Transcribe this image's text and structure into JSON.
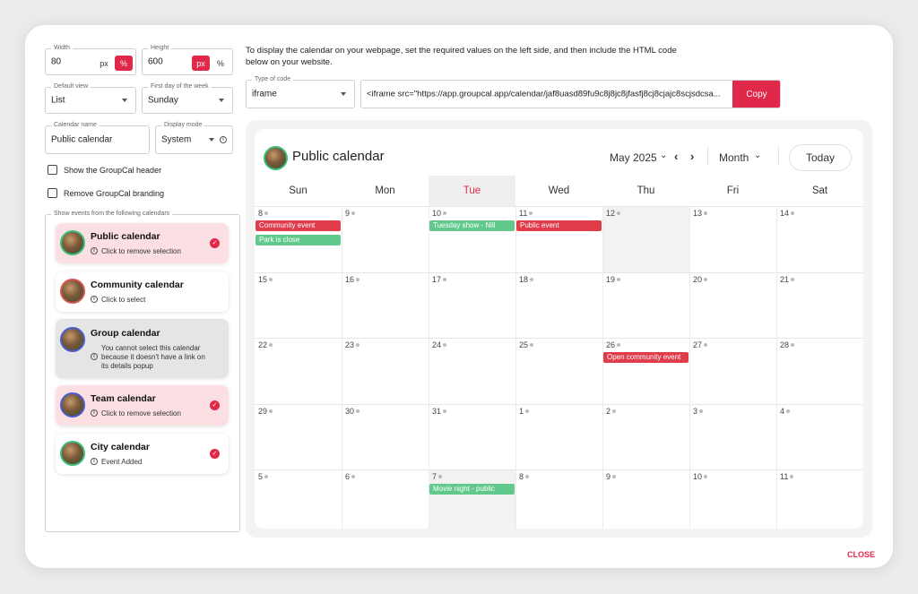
{
  "settings": {
    "width": {
      "label": "Width",
      "value": "80",
      "unit_px": "px",
      "unit_pct": "%"
    },
    "height": {
      "label": "Height",
      "value": "600",
      "unit_px": "px",
      "unit_pct": "%"
    },
    "default_view": {
      "label": "Default view",
      "value": "List"
    },
    "first_day": {
      "label": "First day of the week",
      "value": "Sunday"
    },
    "calendar_name": {
      "label": "Calendar name",
      "value": "Public calendar"
    },
    "display_mode": {
      "label": "Display mode",
      "value": "System"
    },
    "show_header": "Show the GroupCal header",
    "remove_branding": "Remove GroupCal branding",
    "calendars_group_label": "Show events from the following calendars"
  },
  "calendars": [
    {
      "name": "Public calendar",
      "sub": "Click to remove selection"
    },
    {
      "name": "Community calendar",
      "sub": "Click to select"
    },
    {
      "name": "Group calendar",
      "sub_lines": [
        "You cannot select this calendar",
        "because it doesn't have a link on",
        "its details popup"
      ]
    },
    {
      "name": "Team calendar",
      "sub": "Click to remove selection"
    },
    {
      "name": "City calendar",
      "sub": "Event Added"
    }
  ],
  "instructions": {
    "line1": "To display the calendar on your webpage, set the required values on the left side, and then include the HTML code",
    "line2": "below on your website."
  },
  "code": {
    "type_label": "Type of code",
    "type_value": "iframe",
    "snippet": "<iframe src=\"https://app.groupcal.app/calendar/jaf8uasd89fu9c8j8jc8jfasfj8cj8cjajc8scjsdcsa...",
    "copy_label": "Copy"
  },
  "calendar_view": {
    "title": "Public calendar",
    "month_label": "May 2025",
    "view_label": "Month",
    "today_label": "Today",
    "weekdays": [
      "Sun",
      "Mon",
      "Tue",
      "Wed",
      "Thu",
      "Fri",
      "Sat"
    ],
    "weeks": [
      [
        "8",
        "9",
        "10",
        "11",
        "12",
        "13",
        "14"
      ],
      [
        "15",
        "16",
        "17",
        "18",
        "19",
        "20",
        "21"
      ],
      [
        "22",
        "23",
        "24",
        "25",
        "26",
        "27",
        "28"
      ],
      [
        "29",
        "30",
        "31",
        "1",
        "2",
        "3",
        "4"
      ],
      [
        "5",
        "6",
        "7",
        "8",
        "9",
        "10",
        "11"
      ]
    ],
    "events": [
      {
        "title": "Community event",
        "color": "#e03c4a",
        "week": 0,
        "day": 0,
        "slot": 0
      },
      {
        "title": "Park is close",
        "color": "#62c98c",
        "week": 0,
        "day": 0,
        "slot": 1
      },
      {
        "title": "Tuesday show - Nill",
        "color": "#62c98c",
        "week": 0,
        "day": 2,
        "slot": 0
      },
      {
        "title": "Public event",
        "color": "#e03c4a",
        "week": 0,
        "day": 3,
        "slot": 0
      },
      {
        "title": "Open community event",
        "color": "#e03c4a",
        "week": 2,
        "day": 4,
        "slot": 0
      },
      {
        "title": "Movie night - public",
        "color": "#62c98c",
        "week": 4,
        "day": 2,
        "slot": 0
      }
    ]
  },
  "close_label": "CLOSE",
  "colors": {
    "accent": "#e0284a",
    "selected_bg": "#fbdfe2",
    "event_red": "#e03c4a",
    "event_green": "#62c98c"
  }
}
